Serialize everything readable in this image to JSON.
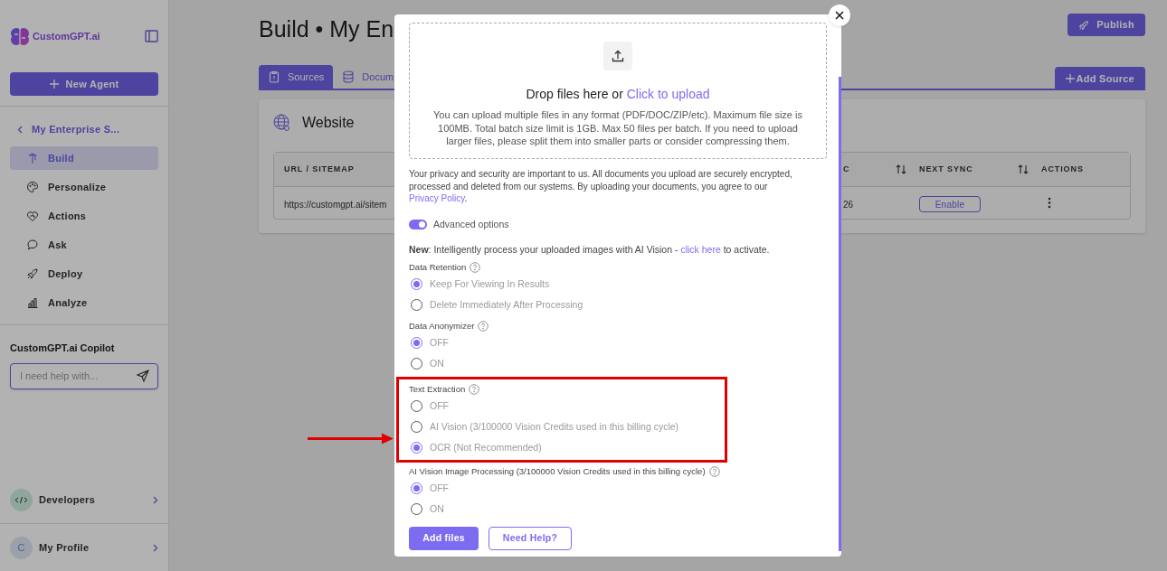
{
  "sidebar": {
    "logo": "CustomGPT.ai",
    "new_agent": "New Agent",
    "agent_back": "My Enterprise S...",
    "nav": [
      {
        "label": "Build",
        "selected": true
      },
      {
        "label": "Personalize",
        "selected": false
      },
      {
        "label": "Actions",
        "selected": false
      },
      {
        "label": "Ask",
        "selected": false
      },
      {
        "label": "Deploy",
        "selected": false
      },
      {
        "label": "Analyze",
        "selected": false
      }
    ],
    "copilot": {
      "title": "CustomGPT.ai Copilot",
      "placeholder": "I need help with..."
    },
    "developers": "Developers",
    "profile": {
      "initial": "C",
      "label": "My Profile"
    }
  },
  "header": {
    "title": "Build • My En",
    "publish": "Publish"
  },
  "tabs": [
    {
      "label": "Sources",
      "selected": true
    },
    {
      "label": "Docum",
      "selected": false
    }
  ],
  "add_source": "Add Source",
  "card": {
    "title": "Website",
    "table": {
      "columns": [
        {
          "label": "URL / SITEMAP",
          "sortable": false
        },
        {
          "label": "C",
          "sortable": true
        },
        {
          "label": "NEXT SYNC",
          "sortable": true
        },
        {
          "label": "ACTIONS",
          "sortable": false
        }
      ],
      "rows": [
        {
          "url": "https://customgpt.ai/sitem",
          "sync": "26",
          "next_sync": "Enable"
        }
      ]
    }
  },
  "modal": {
    "upload": {
      "title": "Drop files here or ",
      "link": "Click to upload",
      "description": "You can upload multiple files in any format (PDF/DOC/ZIP/etc). Maximum file size is 100MB. Total batch size limit is 1GB. Max 50 files per batch. If you need to upload larger files, please split them into smaller parts or consider compressing them."
    },
    "privacy": {
      "before": "Your privacy and security are important to us. All documents you upload are securely encrypted, processed and deleted from our systems. By uploading your documents, you agree to our ",
      "link": "Privacy Policy",
      "after": "."
    },
    "advanced": {
      "label": "Advanced options",
      "on": true
    },
    "notice": {
      "before": "**New**: Intelligently process your uploaded images with AI Vision - ",
      "link": "click here",
      "after": " to activate."
    },
    "groups": [
      {
        "label": "Data Retention",
        "highlighted": false,
        "options": [
          {
            "label": "Keep For Viewing In Results",
            "selected": true
          },
          {
            "label": "Delete Immediately After Processing",
            "selected": false
          }
        ]
      },
      {
        "label": "Data Anonymizer",
        "highlighted": false,
        "options": [
          {
            "label": "OFF",
            "selected": true
          },
          {
            "label": "ON",
            "selected": false
          }
        ]
      },
      {
        "label": "Text Extraction",
        "highlighted": true,
        "options": [
          {
            "label": "OFF",
            "selected": false
          },
          {
            "label": "AI Vision (3/100000 Vision Credits used in this billing cycle)",
            "selected": false
          },
          {
            "label": "OCR (Not Recommended)",
            "selected": true
          }
        ]
      },
      {
        "label": "AI Vision Image Processing (3/100000 Vision Credits used in this billing cycle)",
        "highlighted": false,
        "options": [
          {
            "label": "OFF",
            "selected": true
          },
          {
            "label": "ON",
            "selected": false
          }
        ]
      }
    ],
    "primary_button": "Add files",
    "secondary_button": "Need Help?"
  }
}
